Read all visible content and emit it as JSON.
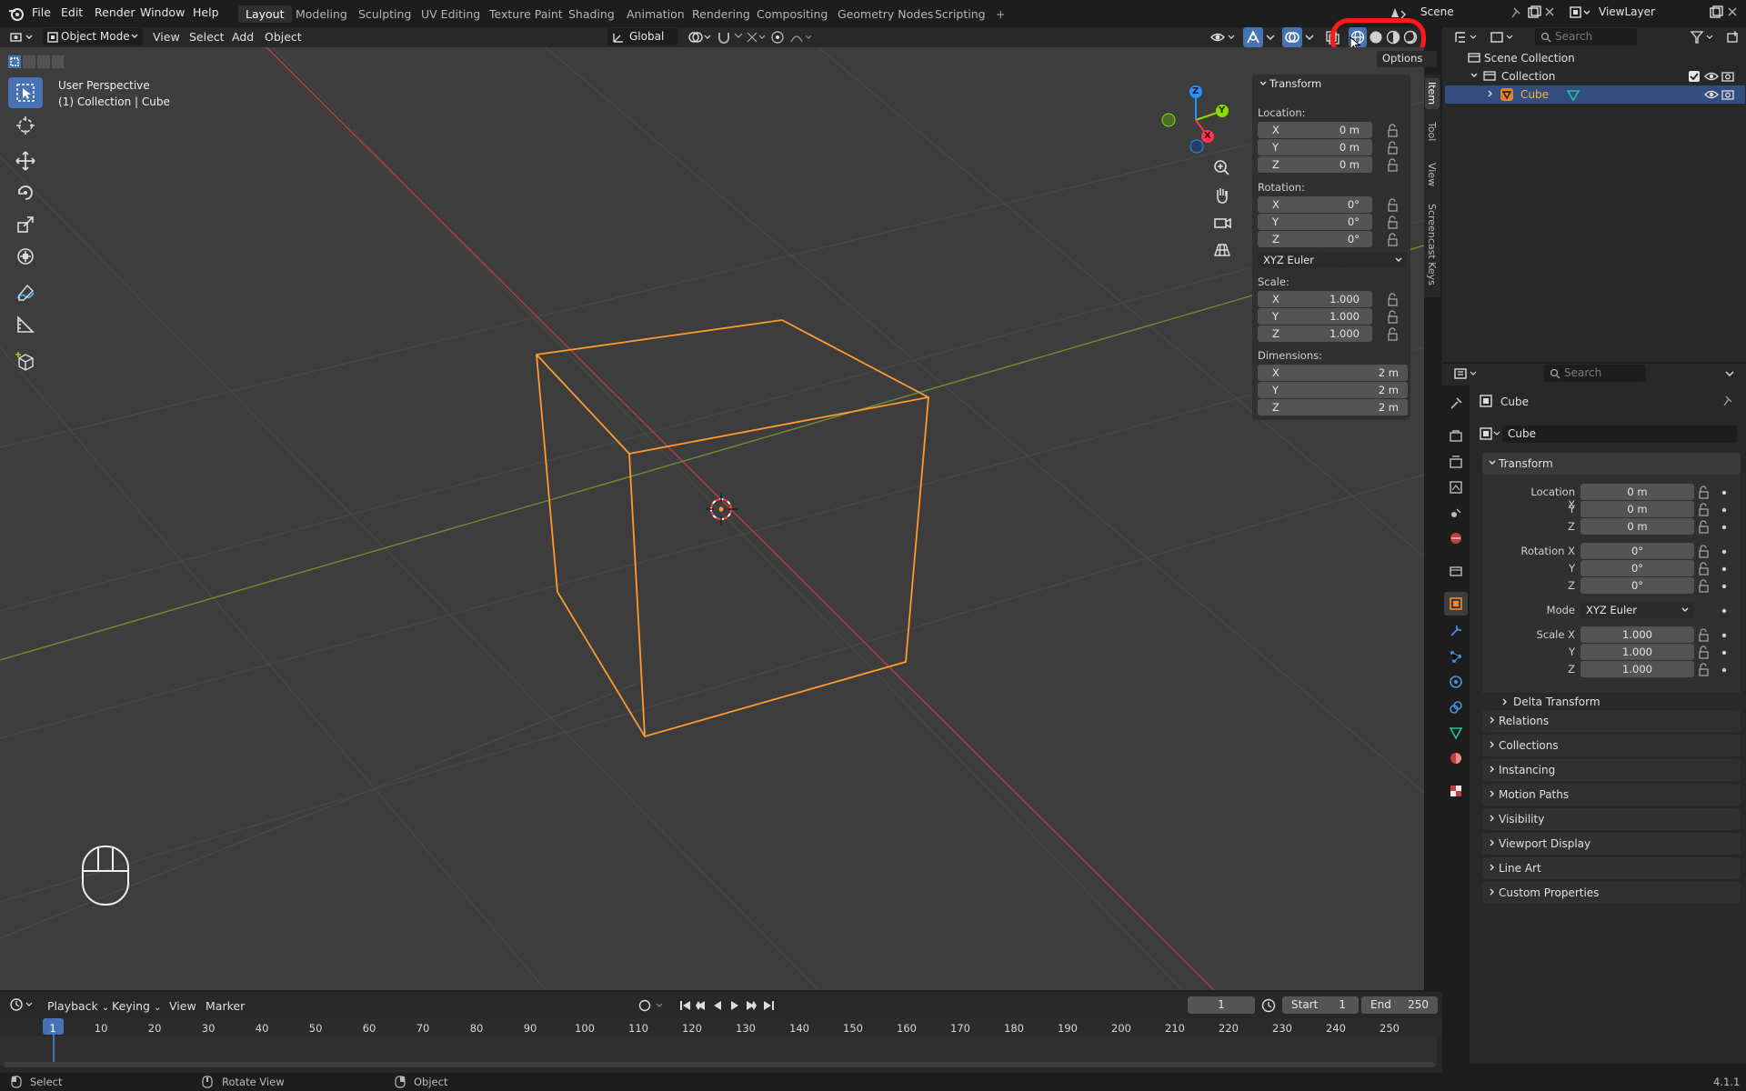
{
  "menu": {
    "file": "File",
    "edit": "Edit",
    "render": "Render",
    "window": "Window",
    "help": "Help"
  },
  "workspaces": [
    "Layout",
    "Modeling",
    "Sculpting",
    "UV Editing",
    "Texture Paint",
    "Shading",
    "Animation",
    "Rendering",
    "Compositing",
    "Geometry Nodes",
    "Scripting"
  ],
  "add_workspace": "+",
  "scene_name": "Scene",
  "view_layer": "ViewLayer",
  "viewport_header": {
    "mode": "Object Mode",
    "view": "View",
    "select": "Select",
    "add": "Add",
    "object": "Object",
    "orientation": "Global",
    "options": "Options"
  },
  "overlay_text": {
    "perspective": "User Perspective",
    "collection": "(1) Collection | Cube"
  },
  "gizmo": {
    "z": "Z",
    "y": "Y",
    "x": "X"
  },
  "npanel_tabs": [
    "Item",
    "Tool",
    "View",
    "Screencast Keys"
  ],
  "transform_panel": {
    "title": "Transform",
    "location_label": "Location:",
    "location": [
      {
        "axis": "X",
        "value": "0 m"
      },
      {
        "axis": "Y",
        "value": "0 m"
      },
      {
        "axis": "Z",
        "value": "0 m"
      }
    ],
    "rotation_label": "Rotation:",
    "rotation": [
      {
        "axis": "X",
        "value": "0°"
      },
      {
        "axis": "Y",
        "value": "0°"
      },
      {
        "axis": "Z",
        "value": "0°"
      }
    ],
    "rotation_mode": "XYZ Euler",
    "scale_label": "Scale:",
    "scale": [
      {
        "axis": "X",
        "value": "1.000"
      },
      {
        "axis": "Y",
        "value": "1.000"
      },
      {
        "axis": "Z",
        "value": "1.000"
      }
    ],
    "dimensions_label": "Dimensions:",
    "dimensions": [
      {
        "axis": "X",
        "value": "2 m"
      },
      {
        "axis": "Y",
        "value": "2 m"
      },
      {
        "axis": "Z",
        "value": "2 m"
      }
    ]
  },
  "outliner": {
    "search_placeholder": "Search",
    "scene_collection": "Scene Collection",
    "collection": "Collection",
    "object": "Cube"
  },
  "properties": {
    "search_placeholder": "Search",
    "object_title": "Cube",
    "object_name": "Cube",
    "transform_title": "Transform",
    "location_x_label": "Location X",
    "y_label": "Y",
    "z_label": "Z",
    "location": [
      "0 m",
      "0 m",
      "0 m"
    ],
    "rotation_x_label": "Rotation X",
    "rotation": [
      "0°",
      "0°",
      "0°"
    ],
    "mode_label": "Mode",
    "mode_value": "XYZ Euler",
    "scale_x_label": "Scale X",
    "scale": [
      "1.000",
      "1.000",
      "1.000"
    ],
    "delta_transform": "Delta Transform",
    "sections": [
      "Relations",
      "Collections",
      "Instancing",
      "Motion Paths",
      "Visibility",
      "Viewport Display",
      "Line Art",
      "Custom Properties"
    ]
  },
  "timeline": {
    "playback": "Playback",
    "keying": "Keying",
    "view": "View",
    "marker": "Marker",
    "current_frame": "1",
    "start_label": "Start",
    "start_value": "1",
    "end_label": "End",
    "end_value": "250",
    "ticks": [
      "1",
      "10",
      "20",
      "30",
      "40",
      "50",
      "60",
      "70",
      "80",
      "90",
      "100",
      "110",
      "120",
      "130",
      "140",
      "150",
      "160",
      "170",
      "180",
      "190",
      "200",
      "210",
      "220",
      "230",
      "240",
      "250"
    ]
  },
  "status": {
    "select": "Select",
    "rotate": "Rotate View",
    "object": "Object",
    "version": "4.1.1"
  },
  "colors": {
    "accent": "#4772b3",
    "selection": "#ff9a2e",
    "highlight_ring": "#ff1a1a",
    "x_axis": "#ff3352",
    "y_axis": "#8bdc00",
    "z_axis": "#2890ff"
  }
}
